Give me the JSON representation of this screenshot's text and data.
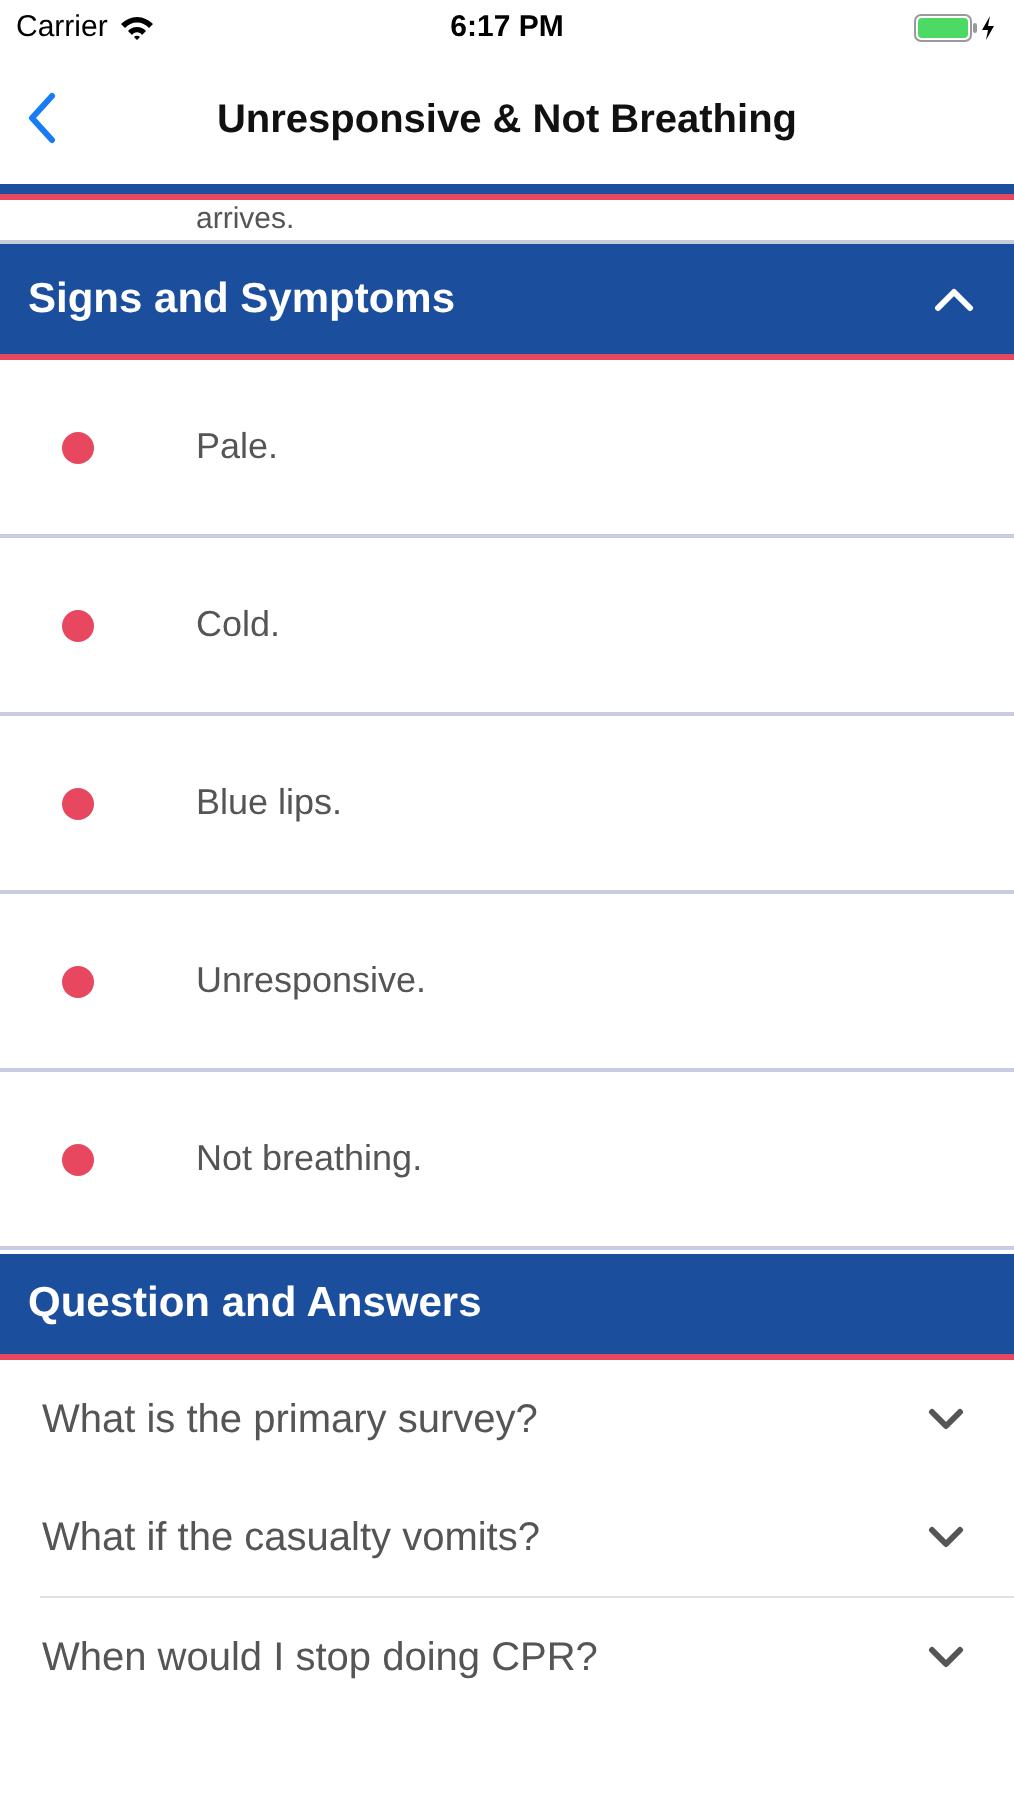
{
  "status_bar": {
    "carrier": "Carrier",
    "time": "6:17 PM"
  },
  "nav": {
    "title": "Unresponsive & Not Breathing"
  },
  "previous_text": "arrives.",
  "symptoms": {
    "title": "Signs and Symptoms",
    "expanded": true,
    "items": [
      {
        "text": "Pale.",
        "color": "#e8485f"
      },
      {
        "text": "Cold.",
        "color": "#e8485f"
      },
      {
        "text": "Blue lips.",
        "color": "#e8485f"
      },
      {
        "text": "Unresponsive.",
        "color": "#e8485f"
      },
      {
        "text": "Not breathing.",
        "color": "#e8485f"
      }
    ]
  },
  "qa": {
    "title": "Question and Answers",
    "questions": [
      {
        "text": "What is the primary survey?",
        "expanded": false
      },
      {
        "text": "What if the casualty vomits?",
        "expanded": false
      },
      {
        "text": "When would I stop doing CPR?",
        "expanded": false
      }
    ]
  }
}
